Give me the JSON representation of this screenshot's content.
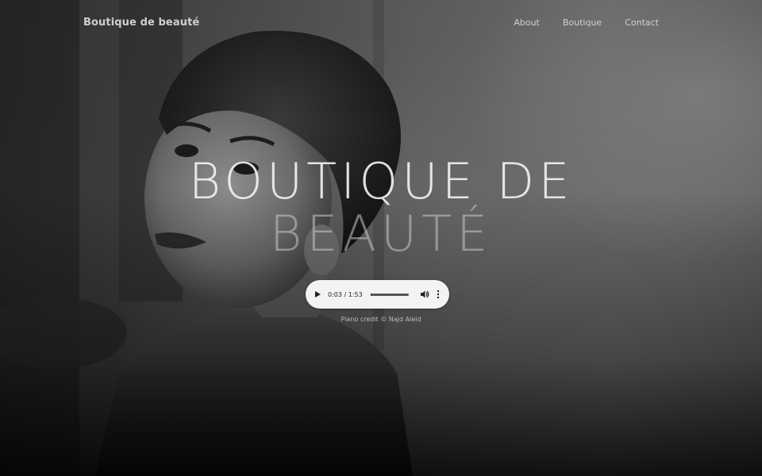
{
  "nav": {
    "brand": "Boutique de beauté",
    "links": [
      {
        "label": "About"
      },
      {
        "label": "Boutique"
      },
      {
        "label": "Contact"
      }
    ]
  },
  "hero": {
    "headline_line1": "BOUTIQUE DE",
    "headline_line2": "BEAUTÉ"
  },
  "audio": {
    "current_time": "0:03",
    "duration": "1:53",
    "time_display": "0:03 / 1:53",
    "progress_fraction": 0.027,
    "play_icon": "play-icon",
    "volume_icon": "volume-icon",
    "menu_icon": "more-vertical-icon"
  },
  "credit": "Piano credit © Najd Aleid",
  "colors": {
    "player_bg": "#f1f3f4",
    "nav_text": "#d2d2d2",
    "headline": "#f0f0f0"
  }
}
